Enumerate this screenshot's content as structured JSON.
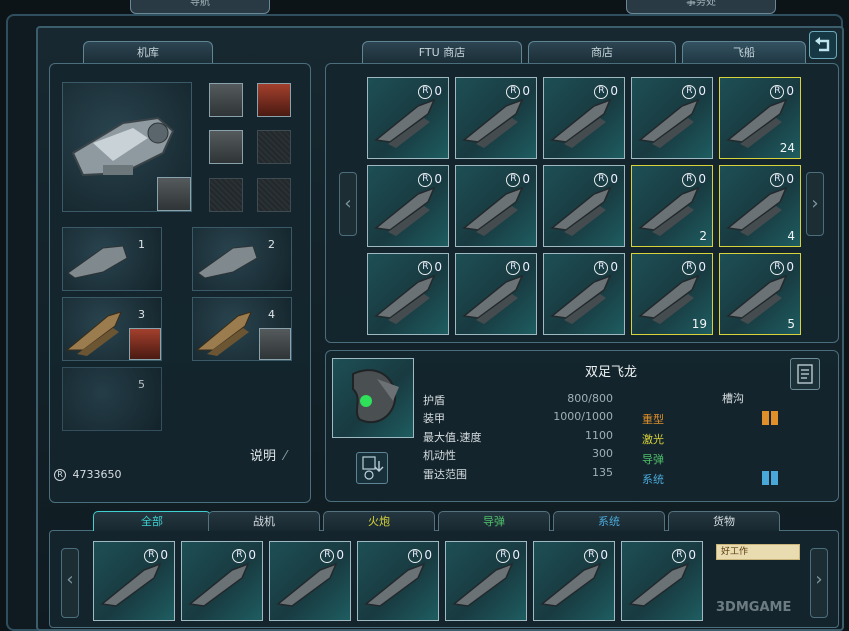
{
  "top_tabs": {
    "left": "导航",
    "right": "事务处"
  },
  "hangar": {
    "tab_label": "机库",
    "ship_slots": [
      "1",
      "2",
      "3",
      "4",
      "5"
    ],
    "explain_label": "说明",
    "credits": "4733650"
  },
  "store_tabs": [
    {
      "label": "FTU 商店"
    },
    {
      "label": "商店"
    },
    {
      "label": "飞船"
    }
  ],
  "store_grid": [
    {
      "count": "0",
      "qty": "",
      "highlight": false
    },
    {
      "count": "0",
      "qty": "",
      "highlight": false
    },
    {
      "count": "0",
      "qty": "",
      "highlight": false
    },
    {
      "count": "0",
      "qty": "",
      "highlight": false
    },
    {
      "count": "0",
      "qty": "24",
      "highlight": true
    },
    {
      "count": "0",
      "qty": "",
      "highlight": false
    },
    {
      "count": "0",
      "qty": "",
      "highlight": false
    },
    {
      "count": "0",
      "qty": "",
      "highlight": false
    },
    {
      "count": "0",
      "qty": "2",
      "highlight": true
    },
    {
      "count": "0",
      "qty": "4",
      "highlight": true
    },
    {
      "count": "0",
      "qty": "",
      "highlight": false
    },
    {
      "count": "0",
      "qty": "",
      "highlight": false
    },
    {
      "count": "0",
      "qty": "",
      "highlight": false
    },
    {
      "count": "0",
      "qty": "19",
      "highlight": true
    },
    {
      "count": "0",
      "qty": "5",
      "highlight": true
    }
  ],
  "detail": {
    "ship_name": "双足飞龙",
    "slots_label": "槽沟",
    "stats": [
      {
        "label": "护盾",
        "value": "800/800"
      },
      {
        "label": "装甲",
        "value": "1000/1000"
      },
      {
        "label": "最大值.速度",
        "value": "1100"
      },
      {
        "label": "机动性",
        "value": "300"
      },
      {
        "label": "雷达范围",
        "value": "135"
      }
    ],
    "categories": [
      {
        "label": "重型",
        "color": "#e0902a"
      },
      {
        "label": "激光",
        "color": "#d9d33a"
      },
      {
        "label": "导弹",
        "color": "#4fc06a"
      },
      {
        "label": "系统",
        "color": "#4aa8d8"
      }
    ]
  },
  "bottom_tabs": [
    {
      "label": "全部",
      "color": "#3fd0d0"
    },
    {
      "label": "战机",
      "color": "#d8dfe2"
    },
    {
      "label": "火炮",
      "color": "#d9d33a"
    },
    {
      "label": "导弹",
      "color": "#4fc06a"
    },
    {
      "label": "系统",
      "color": "#4aa8d8"
    },
    {
      "label": "货物",
      "color": "#d8dfe2"
    }
  ],
  "inventory": [
    {
      "count": "0"
    },
    {
      "count": "0"
    },
    {
      "count": "0"
    },
    {
      "count": "0"
    },
    {
      "count": "0"
    },
    {
      "count": "0"
    },
    {
      "count": "0"
    }
  ],
  "watermark": "3DMGAME",
  "popup_text": "好工作"
}
